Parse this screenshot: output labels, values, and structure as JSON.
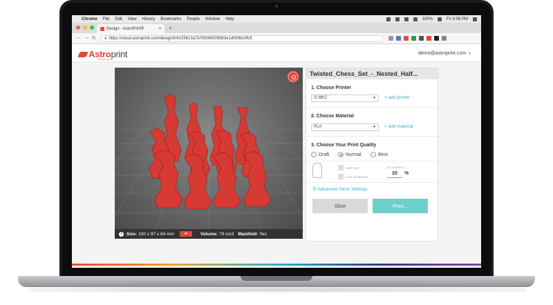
{
  "menubar": {
    "app": "Chrome",
    "items": [
      "File",
      "Edit",
      "View",
      "History",
      "Bookmarks",
      "People",
      "Window",
      "Help"
    ],
    "battery": "100%",
    "clock": "Fri 3:08 PM"
  },
  "browser": {
    "tab_title": "Design - AstroPrint®",
    "url": "https://cloud.astroprint.com/design/info/25613a7b76f345009583e1d059bc0fc5"
  },
  "header": {
    "logo_red": "Astro",
    "logo_grey": "print",
    "logo_sub": "3D Print Cloud",
    "user_email": "demo@astroprint.com"
  },
  "viewer": {
    "size_label": "Size:",
    "size_value": "100 x 97 x 64 mm",
    "volume_label": "Volume:",
    "volume_value": "79 cm3",
    "manifold_label": "Manifold:",
    "manifold_value": "Yes",
    "info_icon": "i",
    "scale_icon": "⇄"
  },
  "panel": {
    "title": "Twisted_Chess_Set_-_Nested_Half...",
    "printer_heading": "1. Choose Printer",
    "printer_selected": "i3 MK2",
    "add_printer": "add printer",
    "material_heading": "2. Choose Material",
    "material_selected": "PLA",
    "add_material": "add material",
    "quality_heading": "3. Choose Your Print Quality",
    "quality_options": [
      "Draft",
      "Normal",
      "Best"
    ],
    "quality_selected": "Normal",
    "support_label": "SUPPORT",
    "plat_label": "PLAT. ADHESION",
    "fill_label": "FILL DENSITY",
    "fill_value": "20",
    "fill_unit": "%",
    "advanced": "Advanced Slicer Settings",
    "slice_btn": "Slice",
    "print_btn": "Print..."
  },
  "colors": {
    "brand_red": "#e8443a",
    "teal": "#2fb1c6",
    "print_btn": "#6fcfcd"
  }
}
